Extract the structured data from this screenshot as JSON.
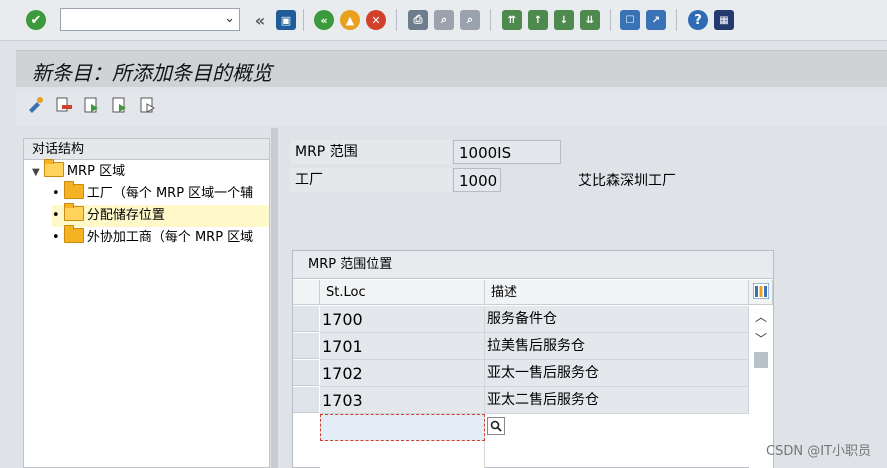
{
  "toolbar": {
    "command_value": "",
    "icons": [
      "check-icon",
      "save-icon",
      "back-icon",
      "exit-icon",
      "cancel-icon",
      "print-icon",
      "find-icon",
      "find-next-icon",
      "first-page-icon",
      "prev-page-icon",
      "next-page-icon",
      "last-page-icon",
      "new-session-icon",
      "shortcut-icon",
      "help-icon",
      "customize-icon"
    ]
  },
  "title": "新条目：所添加条目的概览",
  "app_toolbar": {
    "icons": [
      "change-display-icon",
      "delete-entry-icon",
      "select-all-icon",
      "select-block-icon",
      "deselect-all-icon"
    ]
  },
  "tree": {
    "header": "对话结构",
    "root": "MRP 区域",
    "children": [
      {
        "label": "工厂（每个 MRP 区域一个辅",
        "selected": false
      },
      {
        "label": "分配储存位置",
        "selected": true
      },
      {
        "label": "外协加工商（每个 MRP 区域",
        "selected": false
      }
    ]
  },
  "form": {
    "mrp_area_label": "MRP 范围",
    "mrp_area_value": "1000IS",
    "plant_label": "工厂",
    "plant_value": "1000",
    "plant_desc": "艾比森深圳工厂"
  },
  "table": {
    "title": "MRP 范围位置",
    "columns": [
      "St.Loc",
      "描述"
    ],
    "rows": [
      {
        "code": "1700",
        "desc": "服务备件仓"
      },
      {
        "code": "1701",
        "desc": "拉美售后服务仓"
      },
      {
        "code": "1702",
        "desc": "亚太一售后服务仓"
      },
      {
        "code": "1703",
        "desc": "亚太二售后服务仓"
      }
    ]
  },
  "watermark": "CSDN @IT小职员",
  "colors": {
    "accent": "#2e7d32",
    "selected_row": "#fff8c8",
    "folder": "#f5b324"
  }
}
